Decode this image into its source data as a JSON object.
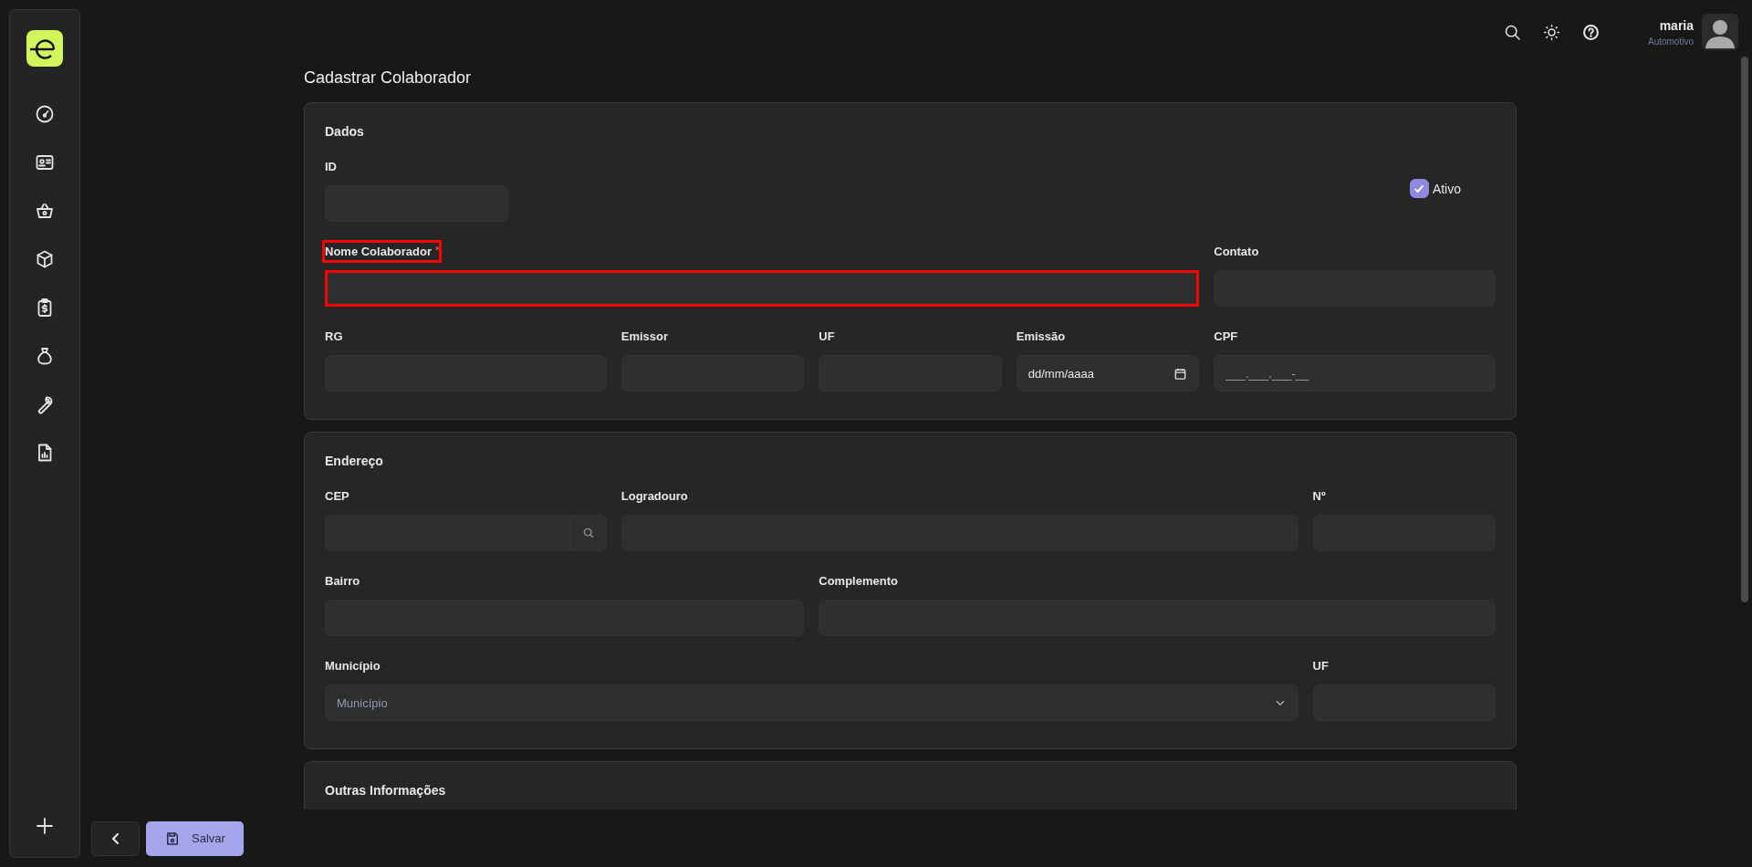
{
  "user": {
    "name": "maria",
    "company": "Automotivo"
  },
  "page_title": "Cadastrar Colaborador",
  "sections": [
    {
      "title": "Dados",
      "fields": [
        {
          "kind": "text",
          "label": "ID"
        },
        {
          "kind": "checkbox",
          "label": "Ativo",
          "checked": true
        },
        {
          "kind": "text",
          "label": "Nome Colaborador",
          "required_mark": "*",
          "invalid": true
        },
        {
          "kind": "text",
          "label": "Contato"
        },
        {
          "kind": "text",
          "label": "RG"
        },
        {
          "kind": "text",
          "label": "Emissor"
        },
        {
          "kind": "text",
          "label": "UF"
        },
        {
          "kind": "date",
          "label": "Emissão",
          "placeholder": "dd/mm/aaaa"
        },
        {
          "kind": "text",
          "label": "CPF",
          "placeholder": "___.___.___-__"
        }
      ]
    },
    {
      "title": "Endereço",
      "fields": [
        {
          "kind": "search",
          "label": "CEP"
        },
        {
          "kind": "text",
          "label": "Logradouro"
        },
        {
          "kind": "text",
          "label": "Nº"
        },
        {
          "kind": "text",
          "label": "Bairro"
        },
        {
          "kind": "text",
          "label": "Complemento"
        },
        {
          "kind": "select",
          "label": "Município",
          "placeholder": "Município"
        },
        {
          "kind": "text",
          "label": "UF"
        }
      ]
    },
    {
      "title": "Outras Informações"
    }
  ],
  "buttons": {
    "save": "Salvar"
  }
}
